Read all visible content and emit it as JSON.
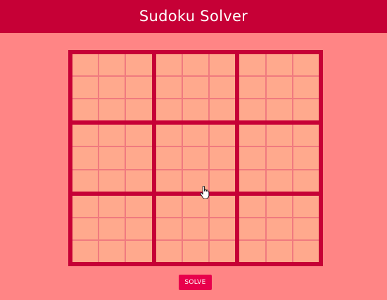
{
  "header": {
    "title": "Sudoku Solver"
  },
  "board": {
    "size": 9,
    "box_size": 3,
    "cells": [
      [
        "",
        "",
        "",
        "",
        "",
        "",
        "",
        "",
        ""
      ],
      [
        "",
        "",
        "",
        "",
        "",
        "",
        "",
        "",
        ""
      ],
      [
        "",
        "",
        "",
        "",
        "",
        "",
        "",
        "",
        ""
      ],
      [
        "",
        "",
        "",
        "",
        "",
        "",
        "",
        "",
        ""
      ],
      [
        "",
        "",
        "",
        "",
        "",
        "",
        "",
        "",
        ""
      ],
      [
        "",
        "",
        "",
        "",
        "",
        "",
        "",
        "",
        ""
      ],
      [
        "",
        "",
        "",
        "",
        "",
        "",
        "",
        "",
        ""
      ],
      [
        "",
        "",
        "",
        "",
        "",
        "",
        "",
        "",
        ""
      ],
      [
        "",
        "",
        "",
        "",
        "",
        "",
        "",
        "",
        ""
      ]
    ]
  },
  "actions": {
    "solve_label": "SOLVE"
  },
  "colors": {
    "background": "#ff8585",
    "header": "#c60036",
    "grid_border": "#c60036",
    "cell": "#ffa98d",
    "button": "#e8004c"
  },
  "cursor": {
    "icon": "hand-pointer-icon"
  }
}
